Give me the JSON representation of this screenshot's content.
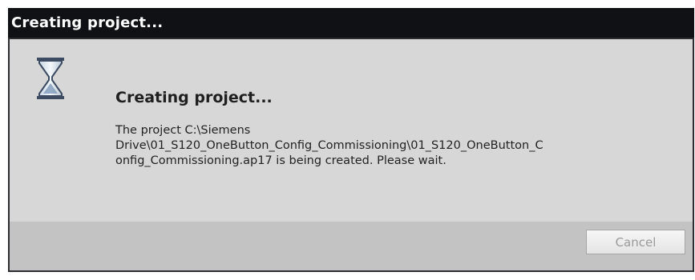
{
  "dialog": {
    "title": "Creating project...",
    "heading": "Creating project...",
    "message": "The project C:\\Siemens\nDrive\\01_S120_OneButton_Config_Commissioning\\01_S120_OneButton_C\nonfig_Commissioning.ap17 is being created. Please wait.",
    "icon": "hourglass-icon",
    "cancel_label": "Cancel",
    "cancel_enabled": false
  },
  "colors": {
    "titlebar": "#0f1114",
    "content_bg": "#d7d7d7",
    "footer_bg": "#c3c3c3",
    "disabled_text": "#9a9a9a"
  }
}
